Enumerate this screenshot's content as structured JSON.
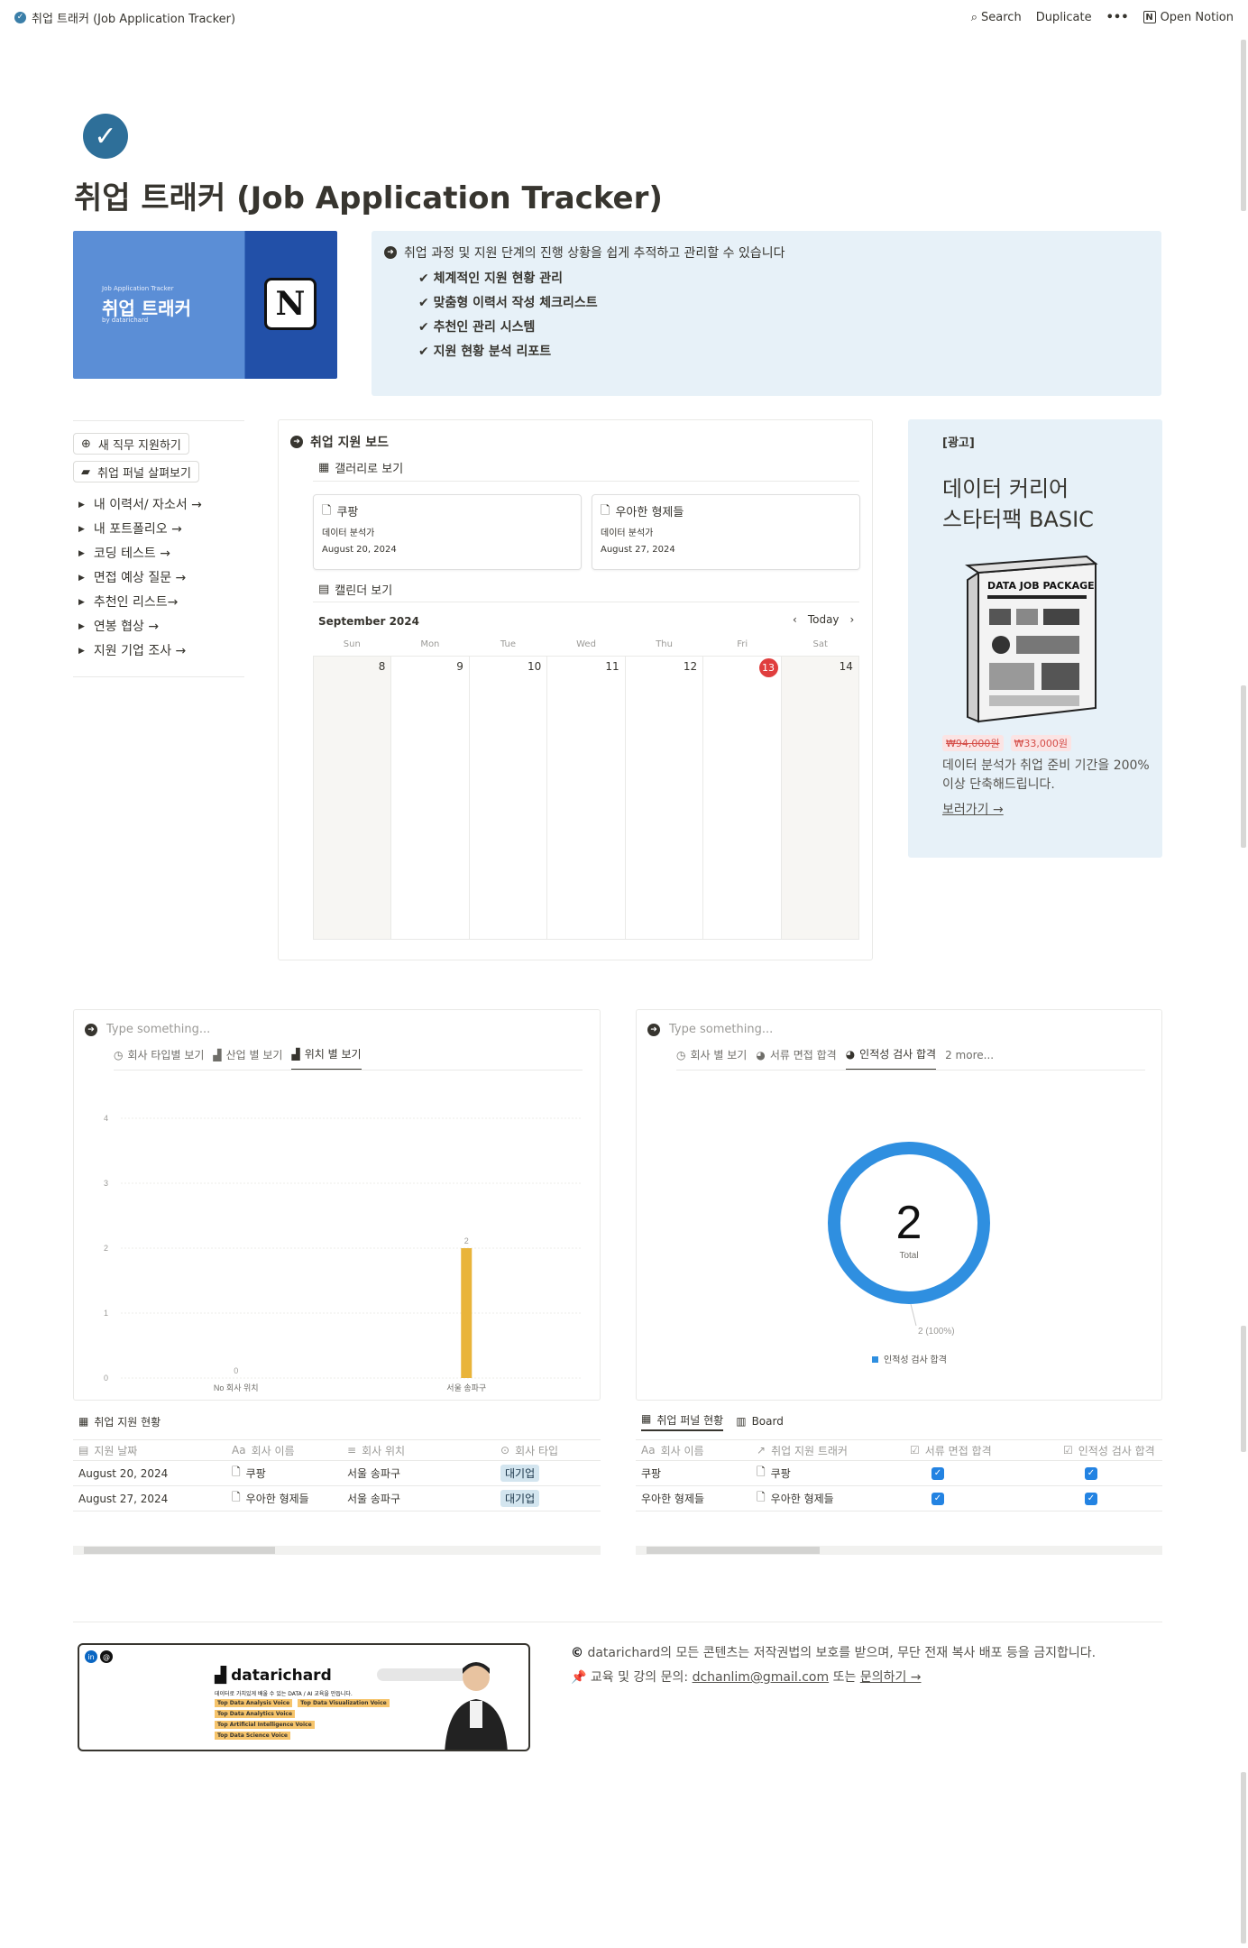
{
  "topbar": {
    "breadcrumb": "취업 트래커 (Job Application Tracker)",
    "search": "Search",
    "duplicate": "Duplicate",
    "more": "•••",
    "open_notion": "Open Notion"
  },
  "page": {
    "title": "취업 트래커 (Job Application Tracker)"
  },
  "cover": {
    "subtitle": "Job Application Tracker",
    "title": "취업 트래커",
    "by": "by datarichard",
    "logo": "N"
  },
  "callout": {
    "lead": "취업 과정 및 지원 단계의 진행 상황을 쉽게 추적하고 관리할 수 있습니다",
    "items": [
      "✔ 체계적인 지원 현황 관리",
      "✔ 맞춤형 이력서 작성 체크리스트",
      "✔ 추천인 관리 시스템",
      "✔ 지원 현황 분석 리포트"
    ]
  },
  "sidebar": {
    "buttons": [
      "새 직무 지원하기",
      "취업 퍼널 살펴보기"
    ],
    "toggles": [
      "내 이력서/ 자소서 →",
      "내 포트폴리오 →",
      "코딩 테스트 →",
      "면접 예상 질문 →",
      "추천인 리스트→",
      "연봉 협상 →",
      "지원 기업 조사 →"
    ]
  },
  "board": {
    "title": "취업 지원 보드",
    "gallery_view": "갤러리로 보기",
    "cards": [
      {
        "title": "쿠팡",
        "position": "데이터 분석가",
        "date": "August 20, 2024"
      },
      {
        "title": "우아한 형제들",
        "position": "데이터 분석가",
        "date": "August 27, 2024"
      }
    ],
    "calendar_view": "캘린더 보기",
    "calendar": {
      "month": "September 2024",
      "today": "Today",
      "days": [
        "Sun",
        "Mon",
        "Tue",
        "Wed",
        "Thu",
        "Fri",
        "Sat"
      ],
      "dates": [
        "8",
        "9",
        "10",
        "11",
        "12",
        "13",
        "14"
      ],
      "today_date": "13"
    }
  },
  "ad": {
    "tag": "[광고]",
    "headline1": "데이터 커리어",
    "headline2": "스타터팩 BASIC",
    "box_title": "DATA JOB PACKAGE",
    "old_price": "₩94,000원",
    "new_price": "₩33,000원",
    "desc": "데이터 분석가 취업 준비 기간을 200% 이상 단축해드립니다.",
    "link": "보러가기 →"
  },
  "chart_left": {
    "placeholder": "Type something...",
    "tabs": [
      "회사 타입별 보기",
      "산업 별 보기",
      "위치 별 보기"
    ],
    "active_tab": 2,
    "chart_data": {
      "type": "bar",
      "categories": [
        "No 회사 위치",
        "서울 송파구"
      ],
      "values": [
        0,
        2
      ],
      "ylim": [
        0,
        4
      ],
      "yticks": [
        "0",
        "1",
        "2",
        "3",
        "4"
      ],
      "bar_color": "#e9b43a",
      "grid": true
    }
  },
  "chart_right": {
    "placeholder": "Type something...",
    "tabs": [
      "회사 별 보기",
      "서류 면접 합격",
      "인적성 검사 합격",
      "2 more..."
    ],
    "active_tab": 2,
    "total_label": "Total",
    "chart_data": {
      "type": "pie",
      "series": [
        {
          "name": "인적성 검사 합격",
          "values": [
            2
          ]
        }
      ],
      "total": "2",
      "slice_label": "2 (100%)",
      "legend": "bottom",
      "color": "#2f8fe0"
    }
  },
  "table_left": {
    "title": "취업 지원 현황",
    "columns": [
      "지원 날짜",
      "회사 이름",
      "회사 위치",
      "회사 타입"
    ],
    "rows": [
      [
        "August 20, 2024",
        "쿠팡",
        "서울 송파구",
        "대기업"
      ],
      [
        "August 27, 2024",
        "우아한 형제들",
        "서울 송파구",
        "대기업"
      ]
    ]
  },
  "table_right": {
    "tabs": [
      "취업 퍼널 현황",
      "Board"
    ],
    "columns": [
      "회사 이름",
      "취업 지원 트래커",
      "서류 면접 합격",
      "인적성 검사 합격"
    ],
    "rows": [
      [
        "쿠팡",
        "쿠팡"
      ],
      [
        "우아한 형제들",
        "우아한 형제들"
      ]
    ]
  },
  "footer": {
    "brand": "datarichard",
    "brand_tagline": "데이터로 가치있게 배울 수 있는 DATA / AI 교육을 만듭니다.",
    "badges": [
      "Top Data Analysis Voice",
      "Top Data Visualization Voice",
      "Top Data Analytics Voice",
      "Top Artificial Intelligence Voice",
      "Top Data Science Voice"
    ],
    "copyright": "datarichard의 모든 콘텐츠는 저작권법의 보호를 받으며, 무단 전재 복사 배포 등을 금지합니다.",
    "contact_prefix": "교육 및 강의 문의: ",
    "email": "dchanlim@gmail.com",
    "contact_mid": " 또는 ",
    "contact_link": "문의하기 →"
  }
}
